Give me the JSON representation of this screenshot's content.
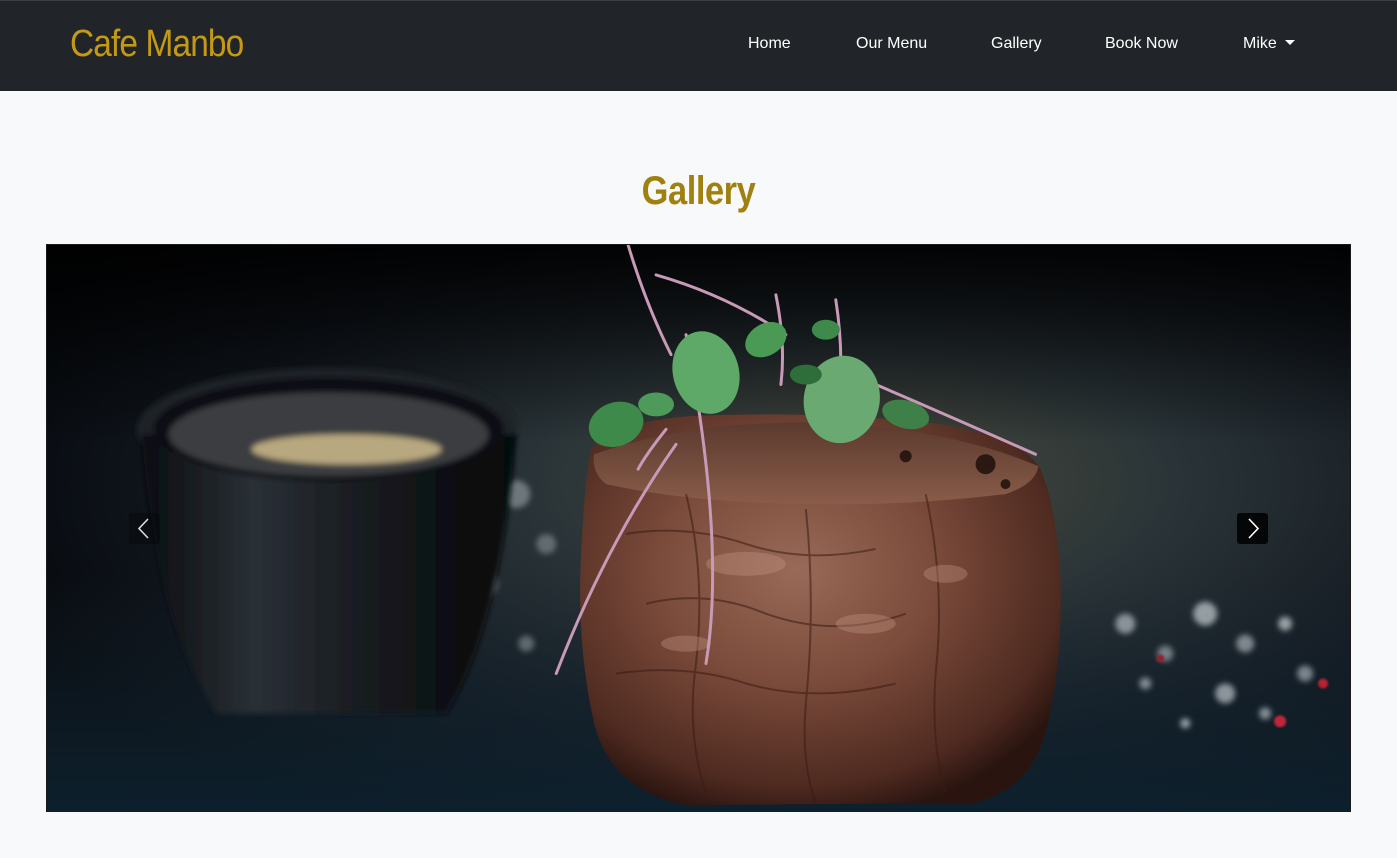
{
  "brand": "Cafe Manbo",
  "nav": {
    "items": [
      "Home",
      "Our Menu",
      "Gallery",
      "Book Now"
    ],
    "user": "Mike"
  },
  "page": {
    "title": "Gallery"
  },
  "carousel": {
    "slide_subject": "steak-with-microgreens-photo",
    "prev_icon": "chevron-left-icon",
    "next_icon": "chevron-right-icon"
  },
  "colors": {
    "navbar_bg": "#212529",
    "brand": "#c49a14",
    "title": "#a0800f",
    "page_bg": "#f8f9fa"
  }
}
